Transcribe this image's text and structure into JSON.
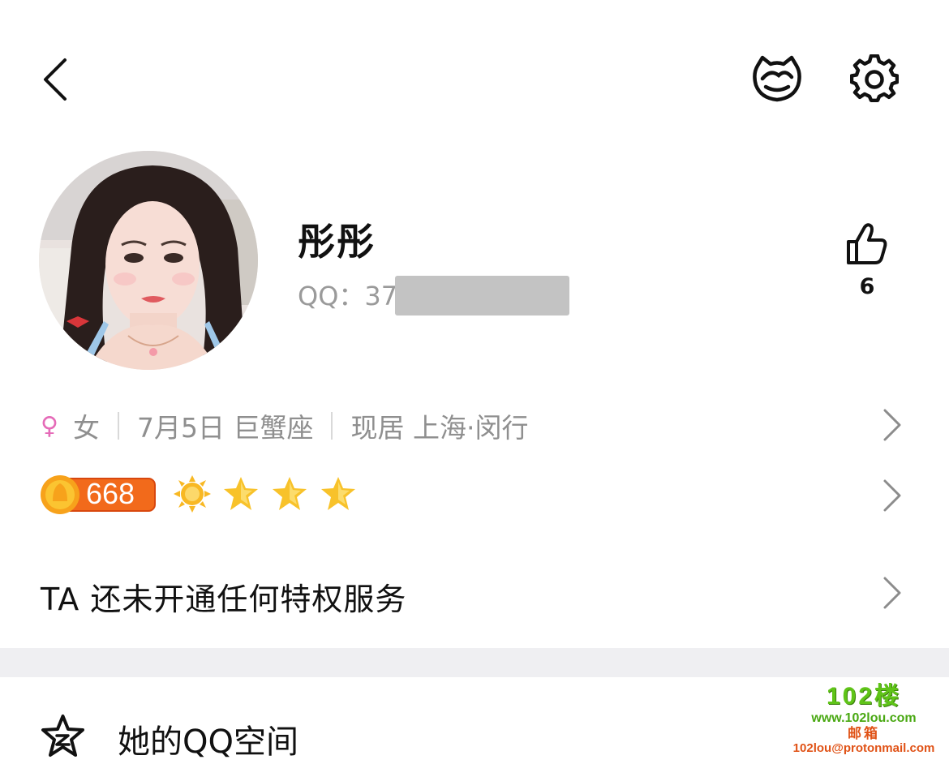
{
  "header": {
    "icons": [
      "back-icon",
      "pet-icon",
      "gear-icon"
    ]
  },
  "profile": {
    "nickname": "彤彤",
    "qq_label": "QQ：37",
    "likes": "6"
  },
  "basic_info": {
    "gender": "女",
    "gender_symbol": "♀",
    "birthday": "7月5日 巨蟹座",
    "location": "现居 上海·闵行"
  },
  "level": {
    "value": "668",
    "icons": [
      "sun-icon",
      "star-icon",
      "star-icon",
      "star-icon"
    ]
  },
  "privilege": {
    "text": "TA 还未开通任何特权服务"
  },
  "qzone": {
    "label": "她的QQ空间"
  },
  "watermark": {
    "logo": "102楼",
    "url": "www.102lou.com",
    "mail_label": "邮箱",
    "mail": "102lou@protonmail.com"
  },
  "colors": {
    "female": "#e56bb8",
    "band": "#efeff2",
    "level_badge": "#f26a1b",
    "star": "#f8c22a"
  }
}
